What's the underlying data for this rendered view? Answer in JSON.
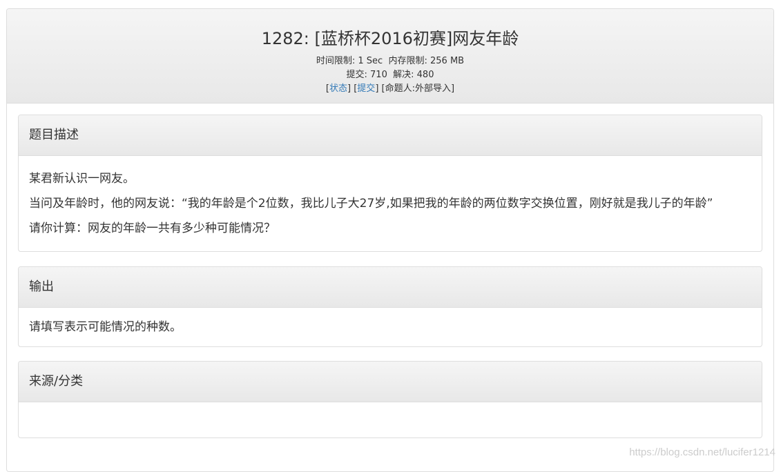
{
  "header": {
    "title": "1282: [蓝桥杯2016初赛]网友年龄",
    "time_limit_label": "时间限制:",
    "time_limit_value": "1 Sec",
    "memory_limit_label": "内存限制:",
    "memory_limit_value": "256 MB",
    "submit_label": "提交:",
    "submit_value": "710",
    "solved_label": "解决:",
    "solved_value": "480",
    "status_link": "状态",
    "submit_link": "提交",
    "author_text": "命题人:外部导入"
  },
  "panels": [
    {
      "heading": "题目描述",
      "lines": [
        "某君新认识一网友。",
        "当问及年龄时，他的网友说：“我的年龄是个2位数，我比儿子大27岁,如果把我的年龄的两位数字交换位置，刚好就是我儿子的年龄”",
        "请你计算：网友的年龄一共有多少种可能情况？"
      ]
    },
    {
      "heading": "输出",
      "lines": [
        "请填写表示可能情况的种数。"
      ]
    },
    {
      "heading": "来源/分类",
      "lines": []
    }
  ],
  "watermark": "https://blog.csdn.net/lucifer1214"
}
